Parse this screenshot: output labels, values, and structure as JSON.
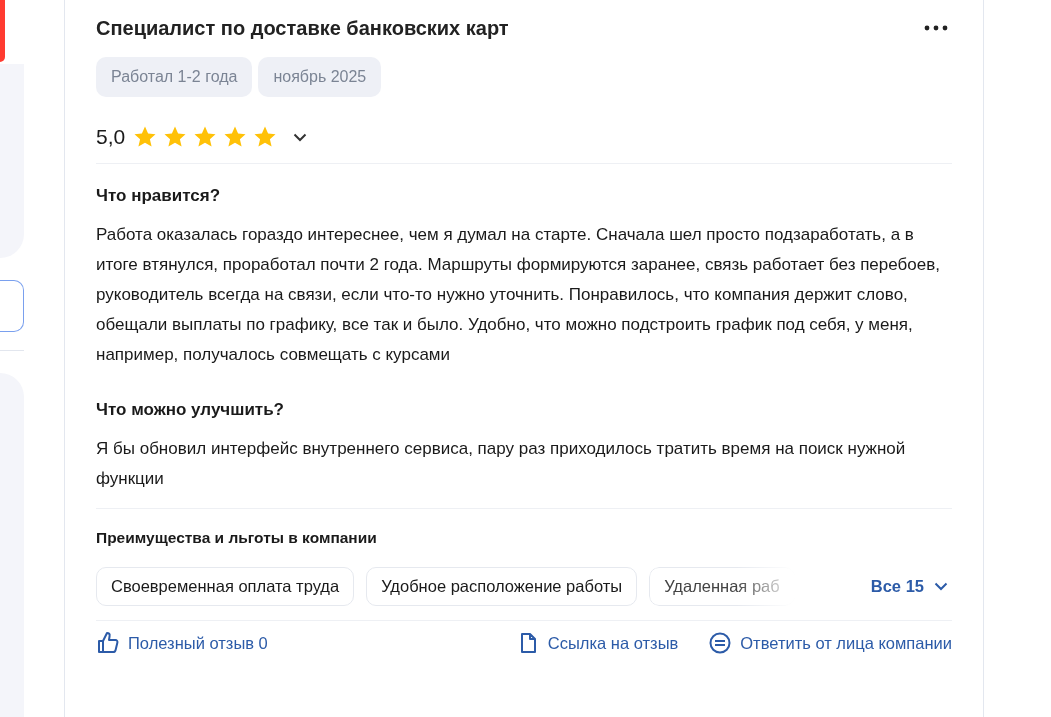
{
  "review": {
    "title": "Специалист по доставке банковских карт",
    "tags": [
      "Работал 1-2 года",
      "ноябрь 2025"
    ],
    "rating": "5,0",
    "stars": 5,
    "sections": [
      {
        "heading": "Что нравится?",
        "text": "Работа оказалась гораздо интереснее, чем я думал на старте. Сначала шел просто подзаработать, а в итоге втянулся, проработал почти 2 года. Маршруты формируются заранее, связь работает без перебоев, руководитель всегда на связи, если что-то нужно уточнить. Понравилось, что компания держит слово, обещали выплаты по графику, все так и было. Удобно, что можно подстроить график под себя, у меня, например, получалось совмещать с курсами"
      },
      {
        "heading": "Что можно улучшить?",
        "text": "Я бы обновил интерфейс внутреннего сервиса, пару раз приходилось тратить время на поиск нужной функции"
      }
    ],
    "benefits": {
      "heading": "Преимущества и льготы в компании",
      "items": [
        "Своевременная оплата труда",
        "Удобное расположение работы",
        "Удаленная раб"
      ],
      "show_all": "Все 15"
    },
    "actions": [
      {
        "kind": "like",
        "label": "Полезный отзыв 0"
      },
      {
        "kind": "link",
        "label": "Ссылка на отзыв"
      },
      {
        "kind": "reply",
        "label": "Ответить от лица компании"
      }
    ]
  }
}
